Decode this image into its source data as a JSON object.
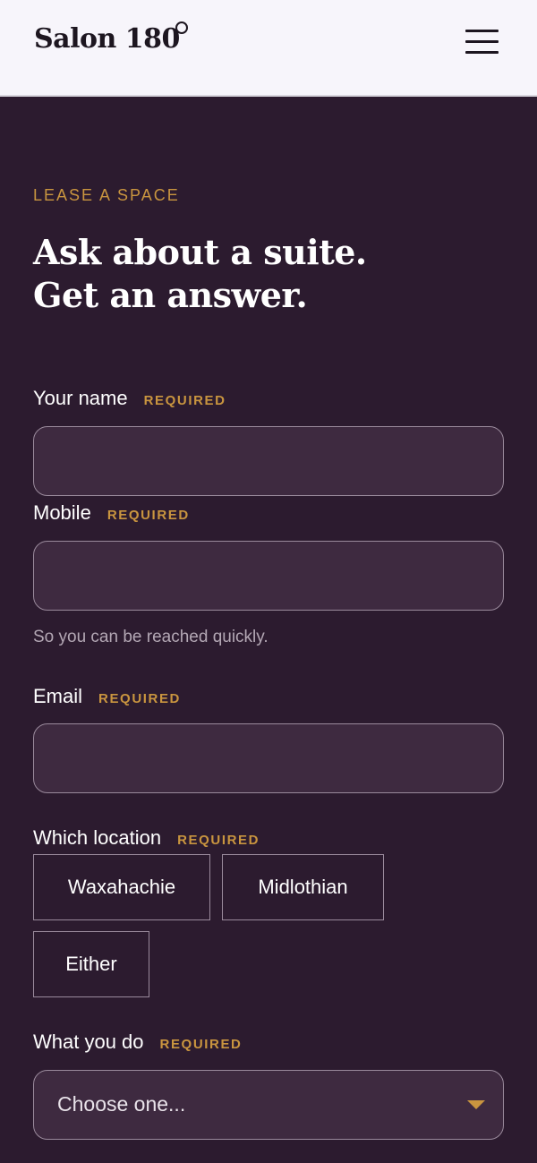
{
  "header": {
    "brand": "Salon 180",
    "degree_icon": "degree-icon",
    "menu_icon": "hamburger-menu-icon"
  },
  "hero": {
    "eyebrow": "LEASE A SPACE",
    "headline_line1": "Ask about a suite.",
    "headline_line2": "Get an answer."
  },
  "form": {
    "required_tag": "REQUIRED",
    "name": {
      "label": "Your name",
      "value": "",
      "placeholder": ""
    },
    "mobile": {
      "label": "Mobile",
      "value": "",
      "placeholder": "",
      "helper": "So you can be reached quickly."
    },
    "email": {
      "label": "Email",
      "value": "",
      "placeholder": ""
    },
    "location": {
      "label": "Which location",
      "options": [
        "Waxahachie",
        "Midlothian",
        "Either"
      ]
    },
    "role": {
      "label": "What you do",
      "selected": "Choose one...",
      "caret_icon": "caret-down-icon"
    }
  },
  "colors": {
    "background": "#2c1b2f",
    "header_bg": "#f7f5fb",
    "accent": "#c9953f",
    "input_bg": "#3e2a40",
    "border": "#9a8a9c"
  }
}
